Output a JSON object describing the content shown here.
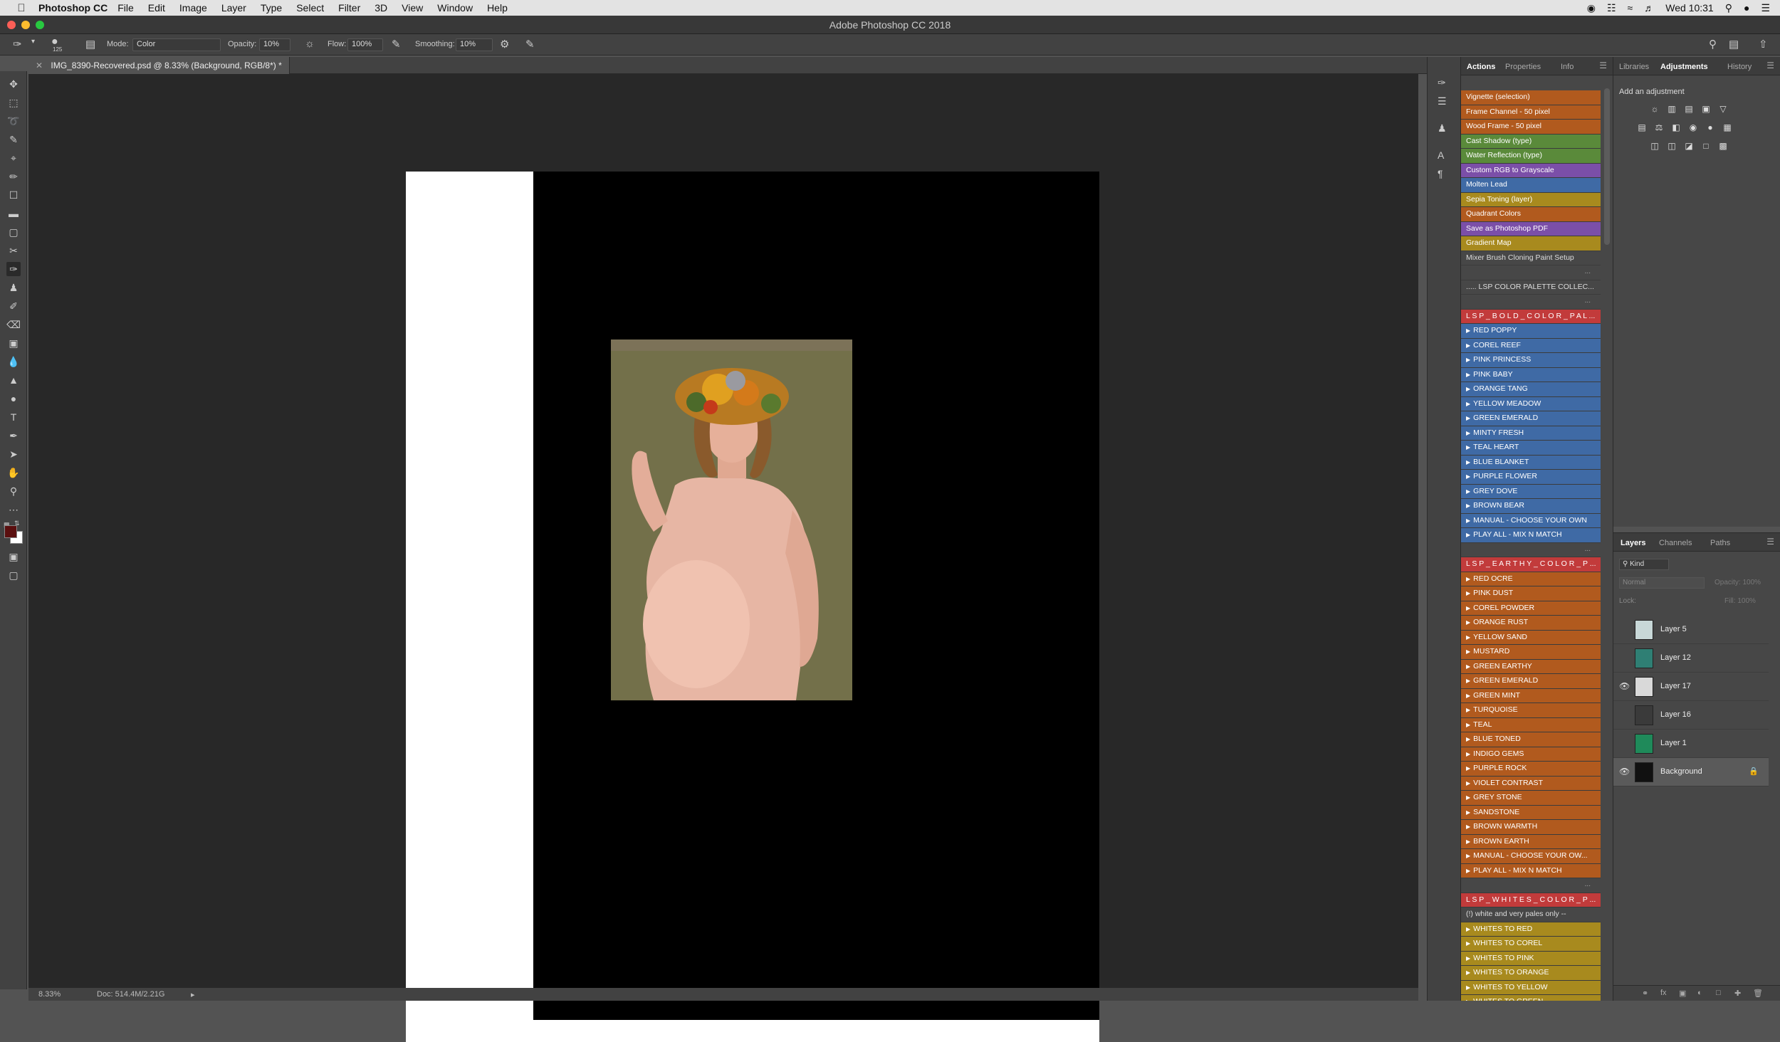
{
  "menubar": {
    "app_name": "Photoshop CC",
    "items": [
      "File",
      "Edit",
      "Image",
      "Layer",
      "Type",
      "Select",
      "Filter",
      "3D",
      "View",
      "Window",
      "Help"
    ],
    "clock": "Wed 10:31"
  },
  "window": {
    "title": "Adobe Photoshop CC 2018"
  },
  "options_bar": {
    "brush_size": "125",
    "mode_label": "Mode:",
    "mode_value": "Color",
    "opacity_label": "Opacity:",
    "opacity_value": "10%",
    "flow_label": "Flow:",
    "flow_value": "100%",
    "smoothing_label": "Smoothing:",
    "smoothing_value": "10%"
  },
  "document": {
    "tab_label": "IMG_8390-Recovered.psd @ 8.33% (Background, RGB/8*) *",
    "zoom": "8.33%",
    "doc_size": "Doc: 514.4M/2.21G"
  },
  "actions_panel": {
    "tabs": [
      "Actions",
      "Properties",
      "Info"
    ],
    "active_tab": "Actions",
    "items": [
      {
        "label": "Vignette (selection)",
        "color": "#b15a1e",
        "triangle": false
      },
      {
        "label": "Frame Channel - 50 pixel",
        "color": "#b15a1e",
        "triangle": false
      },
      {
        "label": "Wood Frame - 50 pixel",
        "color": "#b15a1e",
        "triangle": false
      },
      {
        "label": "Cast Shadow (type)",
        "color": "#5a8a3a",
        "triangle": false
      },
      {
        "label": "Water Reflection (type)",
        "color": "#5a8a3a",
        "triangle": false
      },
      {
        "label": "Custom RGB to Grayscale",
        "color": "#7b4fa8",
        "triangle": false
      },
      {
        "label": "Molten Lead",
        "color": "#3f6aa5",
        "triangle": false
      },
      {
        "label": "Sepia Toning (layer)",
        "color": "#a88a1e",
        "triangle": false
      },
      {
        "label": "Quadrant Colors",
        "color": "#b15a1e",
        "triangle": false
      },
      {
        "label": "Save as Photoshop PDF",
        "color": "#7b4fa8",
        "triangle": false
      },
      {
        "label": "Gradient Map",
        "color": "#a88a1e",
        "triangle": false
      },
      {
        "label": "Mixer Brush Cloning Paint Setup",
        "color": "",
        "triangle": false
      },
      {
        "label": "...",
        "color": "sep",
        "triangle": false
      },
      {
        "label": "..... LSP COLOR PALETTE COLLEC...",
        "color": "",
        "triangle": false
      },
      {
        "label": "...",
        "color": "sep",
        "triangle": false
      },
      {
        "label": "L S P _ B O L D _ C O L O R _ P A L ...",
        "color": "#c23b3b",
        "triangle": false
      },
      {
        "label": "RED POPPY",
        "color": "#3f6aa5",
        "triangle": true
      },
      {
        "label": "COREL REEF",
        "color": "#3f6aa5",
        "triangle": true
      },
      {
        "label": "PINK PRINCESS",
        "color": "#3f6aa5",
        "triangle": true
      },
      {
        "label": "PINK BABY",
        "color": "#3f6aa5",
        "triangle": true
      },
      {
        "label": "ORANGE TANG",
        "color": "#3f6aa5",
        "triangle": true
      },
      {
        "label": "YELLOW MEADOW",
        "color": "#3f6aa5",
        "triangle": true
      },
      {
        "label": "GREEN EMERALD",
        "color": "#3f6aa5",
        "triangle": true
      },
      {
        "label": "MINTY FRESH",
        "color": "#3f6aa5",
        "triangle": true
      },
      {
        "label": "TEAL HEART",
        "color": "#3f6aa5",
        "triangle": true
      },
      {
        "label": "BLUE BLANKET",
        "color": "#3f6aa5",
        "triangle": true
      },
      {
        "label": "PURPLE FLOWER",
        "color": "#3f6aa5",
        "triangle": true
      },
      {
        "label": "GREY DOVE",
        "color": "#3f6aa5",
        "triangle": true
      },
      {
        "label": "BROWN BEAR",
        "color": "#3f6aa5",
        "triangle": true
      },
      {
        "label": "MANUAL - CHOOSE YOUR OWN",
        "color": "#3f6aa5",
        "triangle": true
      },
      {
        "label": "PLAY ALL - MIX N MATCH",
        "color": "#3f6aa5",
        "triangle": true
      },
      {
        "label": "...",
        "color": "sep",
        "triangle": false
      },
      {
        "label": "L S P _ E A R T H Y _ C O L O R _ P ...",
        "color": "#c23b3b",
        "triangle": false
      },
      {
        "label": "RED OCRE",
        "color": "#b15a1e",
        "triangle": true
      },
      {
        "label": "PINK DUST",
        "color": "#b15a1e",
        "triangle": true
      },
      {
        "label": "COREL POWDER",
        "color": "#b15a1e",
        "triangle": true
      },
      {
        "label": "ORANGE RUST",
        "color": "#b15a1e",
        "triangle": true
      },
      {
        "label": "YELLOW SAND",
        "color": "#b15a1e",
        "triangle": true
      },
      {
        "label": "MUSTARD",
        "color": "#b15a1e",
        "triangle": true
      },
      {
        "label": "GREEN EARTHY",
        "color": "#b15a1e",
        "triangle": true
      },
      {
        "label": "GREEN EMERALD",
        "color": "#b15a1e",
        "triangle": true
      },
      {
        "label": "GREEN MINT",
        "color": "#b15a1e",
        "triangle": true
      },
      {
        "label": "TURQUOISE",
        "color": "#b15a1e",
        "triangle": true
      },
      {
        "label": "TEAL",
        "color": "#b15a1e",
        "triangle": true
      },
      {
        "label": "BLUE TONED",
        "color": "#b15a1e",
        "triangle": true
      },
      {
        "label": "INDIGO GEMS",
        "color": "#b15a1e",
        "triangle": true
      },
      {
        "label": "PURPLE ROCK",
        "color": "#b15a1e",
        "triangle": true
      },
      {
        "label": "VIOLET CONTRAST",
        "color": "#b15a1e",
        "triangle": true
      },
      {
        "label": "GREY STONE",
        "color": "#b15a1e",
        "triangle": true
      },
      {
        "label": "SANDSTONE",
        "color": "#b15a1e",
        "triangle": true
      },
      {
        "label": "BROWN WARMTH",
        "color": "#b15a1e",
        "triangle": true
      },
      {
        "label": "BROWN EARTH",
        "color": "#b15a1e",
        "triangle": true
      },
      {
        "label": "MANUAL - CHOOSE YOUR OW...",
        "color": "#b15a1e",
        "triangle": true
      },
      {
        "label": "PLAY ALL - MIX N MATCH",
        "color": "#b15a1e",
        "triangle": true
      },
      {
        "label": "...",
        "color": "sep",
        "triangle": false
      },
      {
        "label": "L S P _ W H I T E S _ C O L O R _ P ...",
        "color": "#c23b3b",
        "triangle": false
      },
      {
        "label": "(!) white and very pales only --",
        "color": "",
        "triangle": false
      },
      {
        "label": "WHITES TO  RED",
        "color": "#a88a1e",
        "triangle": true
      },
      {
        "label": "WHITES TO  COREL",
        "color": "#a88a1e",
        "triangle": true
      },
      {
        "label": "WHITES TO  PINK",
        "color": "#a88a1e",
        "triangle": true
      },
      {
        "label": "WHITES TO  ORANGE",
        "color": "#a88a1e",
        "triangle": true
      },
      {
        "label": "WHITES TO  YELLOW",
        "color": "#a88a1e",
        "triangle": true
      },
      {
        "label": "WHITES TO  GREEN",
        "color": "#a88a1e",
        "triangle": true
      }
    ]
  },
  "adjustments_panel": {
    "tabs": [
      "Libraries",
      "Adjustments",
      "History"
    ],
    "active_tab": "Adjustments",
    "add_label": "Add an adjustment"
  },
  "layers_panel": {
    "tabs": [
      "Layers",
      "Channels",
      "Paths"
    ],
    "active_tab": "Layers",
    "kind_filter": "Kind",
    "blend_mode": "Normal",
    "opacity_label": "Opacity: 100%",
    "lock_label": "Lock:",
    "fill_label": "Fill: 100%",
    "layers": [
      {
        "name": "Layer 5",
        "visible": false,
        "thumb": "#c8d8d8"
      },
      {
        "name": "Layer 12",
        "visible": false,
        "thumb": "#2f7f74"
      },
      {
        "name": "Layer 17",
        "visible": true,
        "thumb": "#d9d9d9"
      },
      {
        "name": "Layer 16",
        "visible": false,
        "thumb": "#3a3a3a"
      },
      {
        "name": "Layer 1",
        "visible": false,
        "thumb": "#1f8a5a"
      },
      {
        "name": "Background",
        "visible": true,
        "thumb": "#111111",
        "locked": true,
        "selected": true
      }
    ]
  },
  "colors": {
    "foreground": "#5a0f0f",
    "background": "#ffffff"
  }
}
